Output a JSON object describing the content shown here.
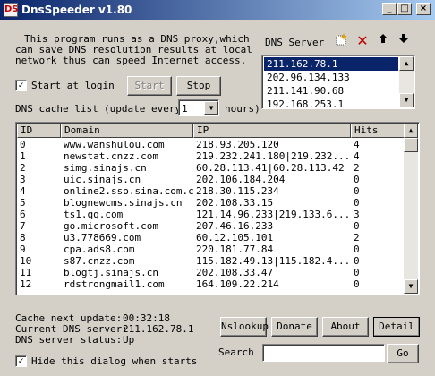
{
  "window": {
    "title": "DnsSpeeder v1.80",
    "minimize": "_",
    "maximize": "□",
    "close": "×"
  },
  "intro": {
    "line1": "This program runs as a DNS proxy,which",
    "line2": "can save DNS resolution results at local",
    "line3": "network thus can speed Internet access."
  },
  "dns_server": {
    "label": "DNS Server",
    "items": [
      "211.162.78.1",
      "202.96.134.133",
      "211.141.90.68",
      "192.168.253.1"
    ],
    "selected_index": 0
  },
  "start_at_login": {
    "label": "Start at login",
    "checked": true,
    "mark": "✓"
  },
  "buttons": {
    "start": "Start",
    "stop": "Stop",
    "nslookup": "Nslookup",
    "donate": "Donate",
    "about": "About",
    "detail": "Detail",
    "go": "Go"
  },
  "cache": {
    "label": "DNS cache list",
    "update_prefix": "(update every",
    "update_value": "1",
    "update_suffix": "hours)"
  },
  "table": {
    "columns": [
      "ID",
      "Domain",
      "IP",
      "Hits"
    ],
    "rows": [
      [
        "0",
        "www.wanshulou.com",
        "218.93.205.120",
        "4"
      ],
      [
        "1",
        "newstat.cnzz.com",
        "219.232.241.180|219.232...",
        "4"
      ],
      [
        "2",
        "simg.sinajs.cn",
        "60.28.113.41|60.28.113.42",
        "2"
      ],
      [
        "3",
        "uic.sinajs.cn",
        "202.106.184.204",
        "0"
      ],
      [
        "4",
        "online2.sso.sina.com.cn",
        "218.30.115.234",
        "0"
      ],
      [
        "5",
        "blognewcms.sinajs.cn",
        "202.108.33.15",
        "0"
      ],
      [
        "6",
        "ts1.qq.com",
        "121.14.96.233|219.133.6...",
        "3"
      ],
      [
        "7",
        "go.microsoft.com",
        "207.46.16.233",
        "0"
      ],
      [
        "8",
        "u3.778669.com",
        "60.12.105.101",
        "2"
      ],
      [
        "9",
        "cpa.ads8.com",
        "220.181.77.84",
        "0"
      ],
      [
        "10",
        "s87.cnzz.com",
        "115.182.49.13|115.182.4...",
        "0"
      ],
      [
        "11",
        "blogtj.sinajs.cn",
        "202.108.33.47",
        "0"
      ],
      [
        "12",
        "rdstrongmail1.com",
        "164.109.22.214",
        "0"
      ]
    ]
  },
  "status": {
    "next_update_label": "Cache next update:",
    "next_update_value": "00:32:18",
    "current_label": "Current DNS server:",
    "current_value": "211.162.78.1",
    "status_label": "DNS server status:",
    "status_value": "Up"
  },
  "hide_dialog": {
    "label": "Hide this dialog when starts",
    "checked": true,
    "mark": "✓"
  },
  "search": {
    "label": "Search",
    "value": ""
  },
  "icons": {
    "add": "new-server-icon",
    "delete": "delete-icon",
    "up": "arrow-up-icon",
    "down": "arrow-down-icon"
  }
}
